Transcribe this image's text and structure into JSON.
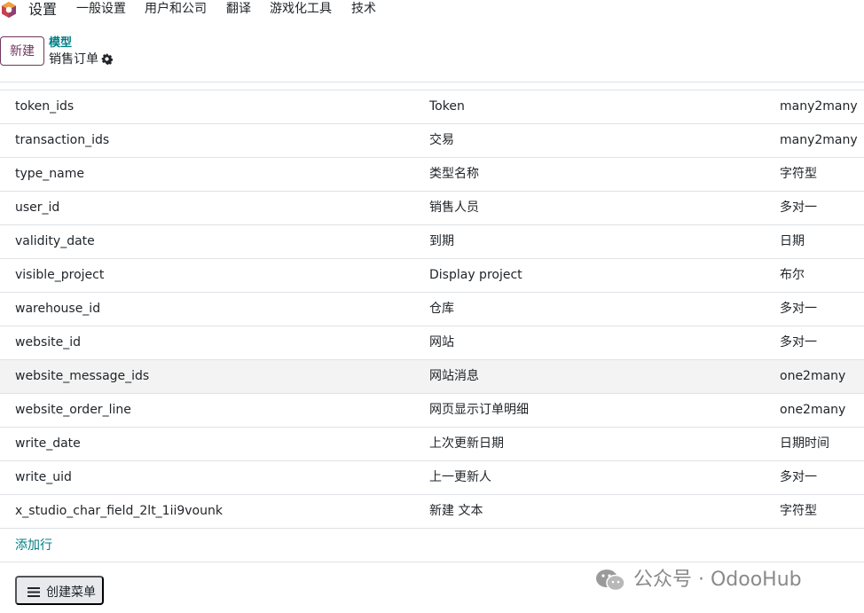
{
  "navbar": {
    "app_name": "设置",
    "menu": [
      "一般设置",
      "用户和公司",
      "翻译",
      "游戏化工具",
      "技术"
    ]
  },
  "control_panel": {
    "new_button": "新建",
    "breadcrumb_parent": "模型",
    "breadcrumb_current": "销售订单"
  },
  "table": {
    "rows": [
      {
        "name": "token_ids",
        "label": "Token",
        "type": "many2many"
      },
      {
        "name": "transaction_ids",
        "label": "交易",
        "type": "many2many"
      },
      {
        "name": "type_name",
        "label": "类型名称",
        "type": "字符型"
      },
      {
        "name": "user_id",
        "label": "销售人员",
        "type": "多对一"
      },
      {
        "name": "validity_date",
        "label": "到期",
        "type": "日期"
      },
      {
        "name": "visible_project",
        "label": "Display project",
        "type": "布尔"
      },
      {
        "name": "warehouse_id",
        "label": "仓库",
        "type": "多对一"
      },
      {
        "name": "website_id",
        "label": "网站",
        "type": "多对一"
      },
      {
        "name": "website_message_ids",
        "label": "网站消息",
        "type": "one2many"
      },
      {
        "name": "website_order_line",
        "label": "网页显示订单明细",
        "type": "one2many"
      },
      {
        "name": "write_date",
        "label": "上次更新日期",
        "type": "日期时间"
      },
      {
        "name": "write_uid",
        "label": "上一更新人",
        "type": "多对一"
      },
      {
        "name": "x_studio_char_field_2lt_1ii9vounk",
        "label": "新建 文本",
        "type": "字符型"
      }
    ],
    "add_line": "添加行"
  },
  "footer": {
    "create_menu_button": "创建菜单"
  },
  "watermark": {
    "text": "公众号 · OdooHub"
  },
  "colors": {
    "brand": "#71385e",
    "link": "#017e84",
    "border": "#dee2e6",
    "hover_row": "#f3f3f3"
  }
}
